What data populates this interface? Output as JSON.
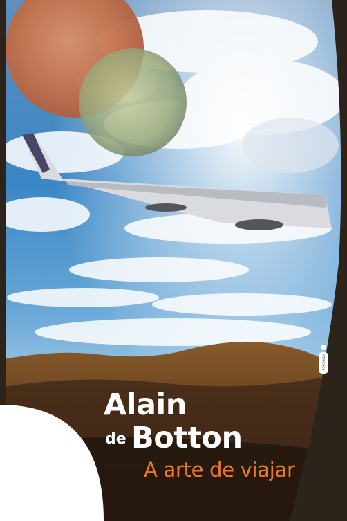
{
  "cover": {
    "author_first": "Alain",
    "author_particle": "de",
    "author_last": "Botton",
    "title": "A arte de viajar",
    "publisher_mark": "intrínseca"
  },
  "colors": {
    "title_orange": "#f07a1e",
    "author_white": "#ffffff",
    "sky_blue": "#3a86c6",
    "window_frame": "#2c231b"
  }
}
